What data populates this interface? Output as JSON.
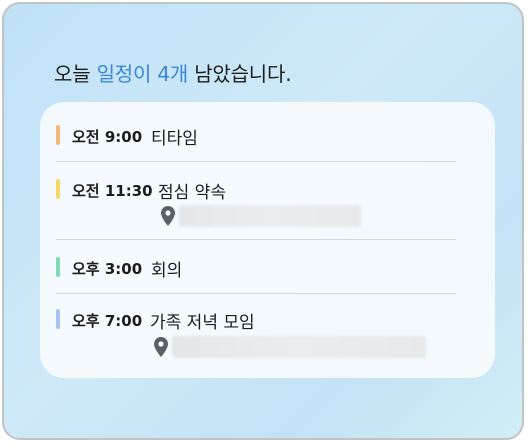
{
  "widget": {
    "headline_prefix": "오늘 ",
    "headline_highlight": "일정이 4개",
    "headline_suffix": " 남았습니다."
  },
  "events": [
    {
      "time": "오전 9:00",
      "title": "티타임",
      "color": "#f7b77a",
      "location": ""
    },
    {
      "time": "오전 11:30",
      "title": "점심 약속",
      "color": "#f5d866",
      "location": "",
      "location_icon": "location-pin-icon"
    },
    {
      "time": "오후 3:00",
      "title": "회의",
      "color": "#7fdcb5",
      "location": ""
    },
    {
      "time": "오후 7:00",
      "title": "가족 저녁 모임",
      "color": "#a9c3f1",
      "location": "",
      "location_icon": "location-pin-icon"
    }
  ],
  "colors": {
    "accent": "#3a86d4",
    "text": "#1c1c1c"
  }
}
